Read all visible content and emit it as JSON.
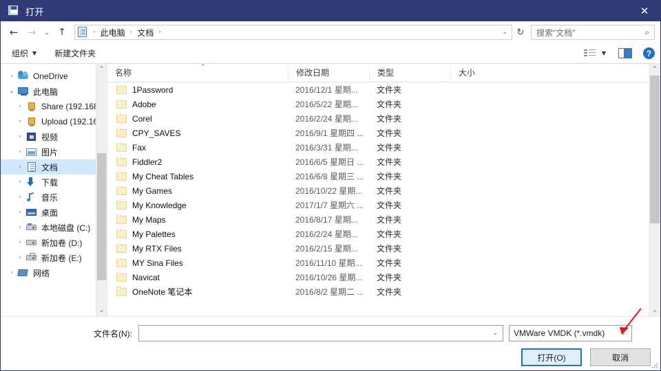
{
  "window": {
    "title": "打开",
    "icon": "floppy-disk-icon",
    "close_label": "✕",
    "titlebar_color": "#2f3a76"
  },
  "nav": {
    "back": "←",
    "forward": "→",
    "recent": "⌄",
    "up": "↑",
    "refresh": "↻",
    "breadcrumb": [
      "此电脑",
      "文档"
    ],
    "breadcrumb_sep": "›",
    "address_chevron": "⌄"
  },
  "search": {
    "placeholder": "搜索\"文档\"",
    "icon": "search-icon"
  },
  "command_bar": {
    "organize": "组织",
    "organize_caret": "▼",
    "new_folder": "新建文件夹",
    "view_caret": "▼",
    "help": "?"
  },
  "sidebar": {
    "items": [
      {
        "label": "OneDrive",
        "icon": "cloud-icon",
        "level": 1,
        "expander": "›",
        "selected": false
      },
      {
        "label": "此电脑",
        "icon": "computer-icon",
        "level": 1,
        "expander": "⌄",
        "selected": false
      },
      {
        "label": "Share (192.168",
        "icon": "network-drive-icon",
        "level": 2,
        "expander": "›",
        "selected": false
      },
      {
        "label": "Upload (192.16",
        "icon": "network-drive-icon",
        "level": 2,
        "expander": "›",
        "selected": false
      },
      {
        "label": "视频",
        "icon": "videos-icon",
        "level": 2,
        "expander": "›",
        "selected": false
      },
      {
        "label": "图片",
        "icon": "pictures-icon",
        "level": 2,
        "expander": "›",
        "selected": false
      },
      {
        "label": "文档",
        "icon": "documents-icon",
        "level": 2,
        "expander": "›",
        "selected": true
      },
      {
        "label": "下载",
        "icon": "downloads-icon",
        "level": 2,
        "expander": "›",
        "selected": false
      },
      {
        "label": "音乐",
        "icon": "music-icon",
        "level": 2,
        "expander": "›",
        "selected": false
      },
      {
        "label": "桌面",
        "icon": "desktop-icon",
        "level": 2,
        "expander": "›",
        "selected": false
      },
      {
        "label": "本地磁盘 (C:)",
        "icon": "system-drive-icon",
        "level": 2,
        "expander": "›",
        "selected": false
      },
      {
        "label": "新加卷 (D:)",
        "icon": "drive-icon",
        "level": 2,
        "expander": "›",
        "selected": false
      },
      {
        "label": "新加卷 (E:)",
        "icon": "locked-drive-icon",
        "level": 2,
        "expander": "›",
        "selected": false
      },
      {
        "label": "网络",
        "icon": "network-icon",
        "level": 1,
        "expander": "›",
        "selected": false
      }
    ],
    "scroll_up": "⌃",
    "scroll_down": "⌄"
  },
  "file_list": {
    "columns": [
      "名称",
      "修改日期",
      "类型",
      "大小"
    ],
    "sort_indicator": "⌃",
    "scroll_up": "⌃",
    "scroll_down": "⌄",
    "rows": [
      {
        "name": "1Password",
        "date": "2016/12/1 星期...",
        "type": "文件夹",
        "size": ""
      },
      {
        "name": "Adobe",
        "date": "2016/5/22 星期...",
        "type": "文件夹",
        "size": ""
      },
      {
        "name": "Corel",
        "date": "2016/2/24 星期...",
        "type": "文件夹",
        "size": ""
      },
      {
        "name": "CPY_SAVES",
        "date": "2016/9/1 星期四 ...",
        "type": "文件夹",
        "size": ""
      },
      {
        "name": "Fax",
        "date": "2016/3/31 星期...",
        "type": "文件夹",
        "size": ""
      },
      {
        "name": "Fiddler2",
        "date": "2016/6/5 星期日 ...",
        "type": "文件夹",
        "size": ""
      },
      {
        "name": "My Cheat Tables",
        "date": "2016/6/8 星期三 ...",
        "type": "文件夹",
        "size": ""
      },
      {
        "name": "My Games",
        "date": "2016/10/22 星期...",
        "type": "文件夹",
        "size": ""
      },
      {
        "name": "My Knowledge",
        "date": "2017/1/7 星期六 ...",
        "type": "文件夹",
        "size": ""
      },
      {
        "name": "My Maps",
        "date": "2016/8/17 星期...",
        "type": "文件夹",
        "size": ""
      },
      {
        "name": "My Palettes",
        "date": "2016/2/24 星期...",
        "type": "文件夹",
        "size": ""
      },
      {
        "name": "My RTX Files",
        "date": "2016/2/15 星期...",
        "type": "文件夹",
        "size": ""
      },
      {
        "name": "MY Sina Files",
        "date": "2016/11/10 星期...",
        "type": "文件夹",
        "size": ""
      },
      {
        "name": "Navicat",
        "date": "2016/10/26 星期...",
        "type": "文件夹",
        "size": ""
      },
      {
        "name": "OneNote 笔记本",
        "date": "2016/8/2 星期二 ...",
        "type": "文件夹",
        "size": ""
      }
    ]
  },
  "footer": {
    "filename_label": "文件名(N):",
    "filename_value": "",
    "filename_chevron": "⌄",
    "filetype_value": "VMWare VMDK (*.vmdk)",
    "filetype_chevron": "⌄",
    "open_button": "打开(O)",
    "cancel_button": "取消",
    "accent_color": "#1d72c4"
  },
  "annotation": {
    "arrow_color": "#e8141c",
    "name": "red-arrow-pointing-to-file-type-dropdown"
  }
}
